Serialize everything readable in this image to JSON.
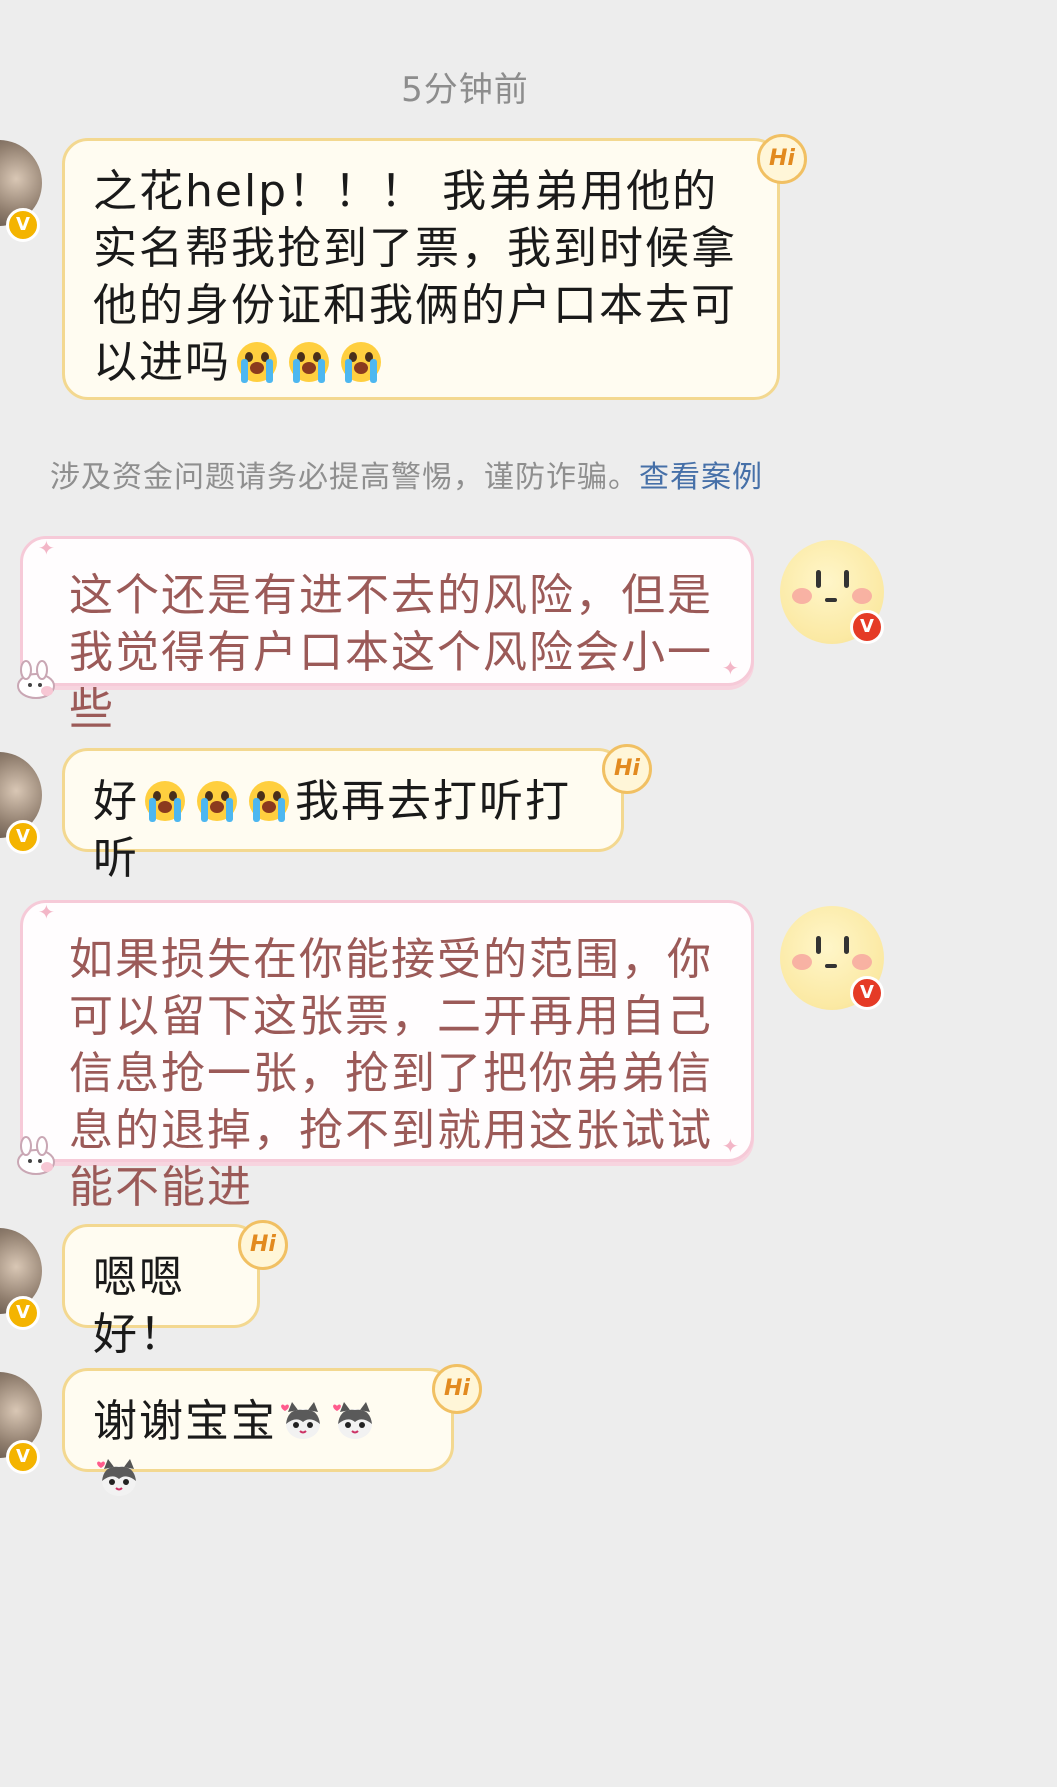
{
  "timestamp": "5分钟前",
  "warning": {
    "text": "涉及资金问题请务必提高警惕，谨防诈骗。",
    "link": "查看案例"
  },
  "badge_hi": "Hi",
  "badge_v": "V",
  "messages": [
    {
      "side": "left",
      "text": "之花help！！！ 我弟弟用他的实名帮我抢到了票，我到时候拿他的身份证和我俩的户口本去可以进吗",
      "emoji": [
        "crying-face",
        "crying-face",
        "crying-face"
      ]
    },
    {
      "side": "right",
      "text": "这个还是有进不去的风险，但是我觉得有户口本这个风险会小一些"
    },
    {
      "side": "left",
      "text_prefix": "好",
      "text": "我再去打听打听",
      "emoji": [
        "crying-face",
        "crying-face",
        "crying-face"
      ]
    },
    {
      "side": "right",
      "text": "如果损失在你能接受的范围，你可以留下这张票，二开再用自己信息抢一张，抢到了把你弟弟信息的退掉，抢不到就用这张试试能不能进"
    },
    {
      "side": "left",
      "text": "嗯嗯好！"
    },
    {
      "side": "left",
      "text": "谢谢宝宝",
      "emoji": [
        "cat-heart",
        "cat-heart",
        "cat-heart"
      ]
    }
  ],
  "colors": {
    "background": "#ededed",
    "cream_bubble": "#fffcf1",
    "cream_border": "#f3d890",
    "pink_border": "#f6cad8",
    "pink_text": "#9b5a58",
    "link": "#4670a8"
  }
}
